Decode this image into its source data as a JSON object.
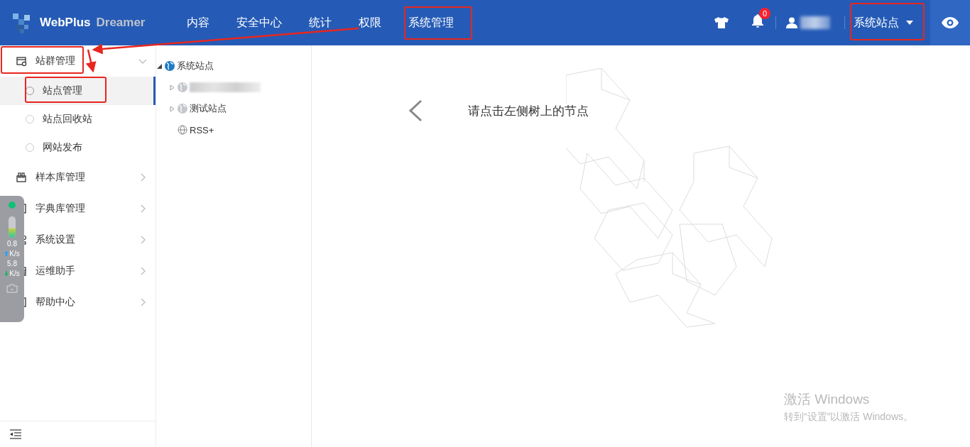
{
  "header": {
    "logo": {
      "name": "WebPlus",
      "suffix": "Dreamer"
    },
    "nav": [
      "内容",
      "安全中心",
      "统计",
      "权限",
      "系统管理"
    ],
    "notifications": {
      "count": "0"
    },
    "site_selector": {
      "label": "系统站点"
    }
  },
  "sidebar": {
    "groups": [
      {
        "label": "站群管理",
        "expanded": true,
        "children": [
          {
            "label": "站点管理",
            "selected": true
          },
          {
            "label": "站点回收站",
            "selected": false
          },
          {
            "label": "网站发布",
            "selected": false
          }
        ]
      },
      {
        "label": "样本库管理",
        "expanded": false
      },
      {
        "label": "字典库管理",
        "expanded": false
      },
      {
        "label": "系统设置",
        "expanded": false
      },
      {
        "label": "运维助手",
        "expanded": false
      },
      {
        "label": "帮助中心",
        "expanded": false
      }
    ]
  },
  "tree": [
    {
      "label": "系统站点",
      "kind": "site",
      "expanded": true,
      "children": [
        {
          "kind": "redacted",
          "expanded": false
        },
        {
          "label": "测试站点",
          "kind": "site",
          "expanded": false
        },
        {
          "label": "RSS+",
          "kind": "link"
        }
      ]
    }
  ],
  "main": {
    "hint": "请点击左侧树上的节点"
  },
  "speed_widget": {
    "level": 0.45,
    "upload": "0.8",
    "upload_unit": "K/s",
    "download": "5.8",
    "download_unit": "K/s"
  },
  "activation_notice": {
    "title": "激活 Windows",
    "text": "转到“设置”以激活 Windows。"
  }
}
